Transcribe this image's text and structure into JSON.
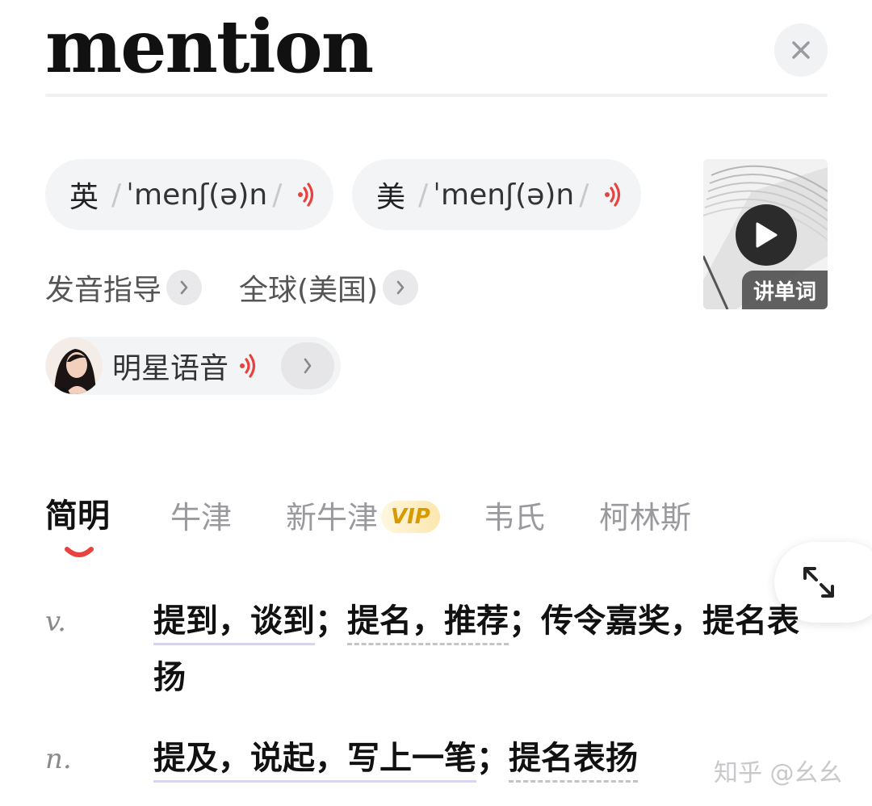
{
  "header": {
    "word": "mention",
    "close_icon": "close-icon"
  },
  "pronunciations": [
    {
      "region": "英",
      "slash_open": "/",
      "ipa": "ˈmenʃ(ə)n",
      "slash_close": "/"
    },
    {
      "region": "美",
      "slash_open": "/",
      "ipa": "ˈmenʃ(ə)n",
      "slash_close": "/"
    }
  ],
  "video": {
    "label": "讲单词"
  },
  "links": {
    "guide": "发音指导",
    "global": "全球(美国)"
  },
  "star_voice": {
    "label": "明星语音"
  },
  "tabs": [
    {
      "label": "简明",
      "active": true
    },
    {
      "label": "牛津",
      "active": false
    },
    {
      "label": "新牛津",
      "active": false,
      "badge": "VIP"
    },
    {
      "label": "韦氏",
      "active": false
    },
    {
      "label": "柯林斯",
      "active": false
    }
  ],
  "definitions": [
    {
      "pos": "v.",
      "seg1": "提到，谈到",
      "sep1": "；",
      "seg2": "提名，推荐",
      "sep2": "；",
      "seg3": "传令嘉奖，提名表扬"
    },
    {
      "pos": "n.",
      "seg1": "提及，说起，写上一笔",
      "sep1": "；",
      "seg2": "提名表扬"
    }
  ],
  "watermark": "知乎 @幺幺",
  "colors": {
    "accent": "#e8423f",
    "active_text": "#111111",
    "inactive_text": "#9a9a9e",
    "vip": "#d89a00"
  }
}
